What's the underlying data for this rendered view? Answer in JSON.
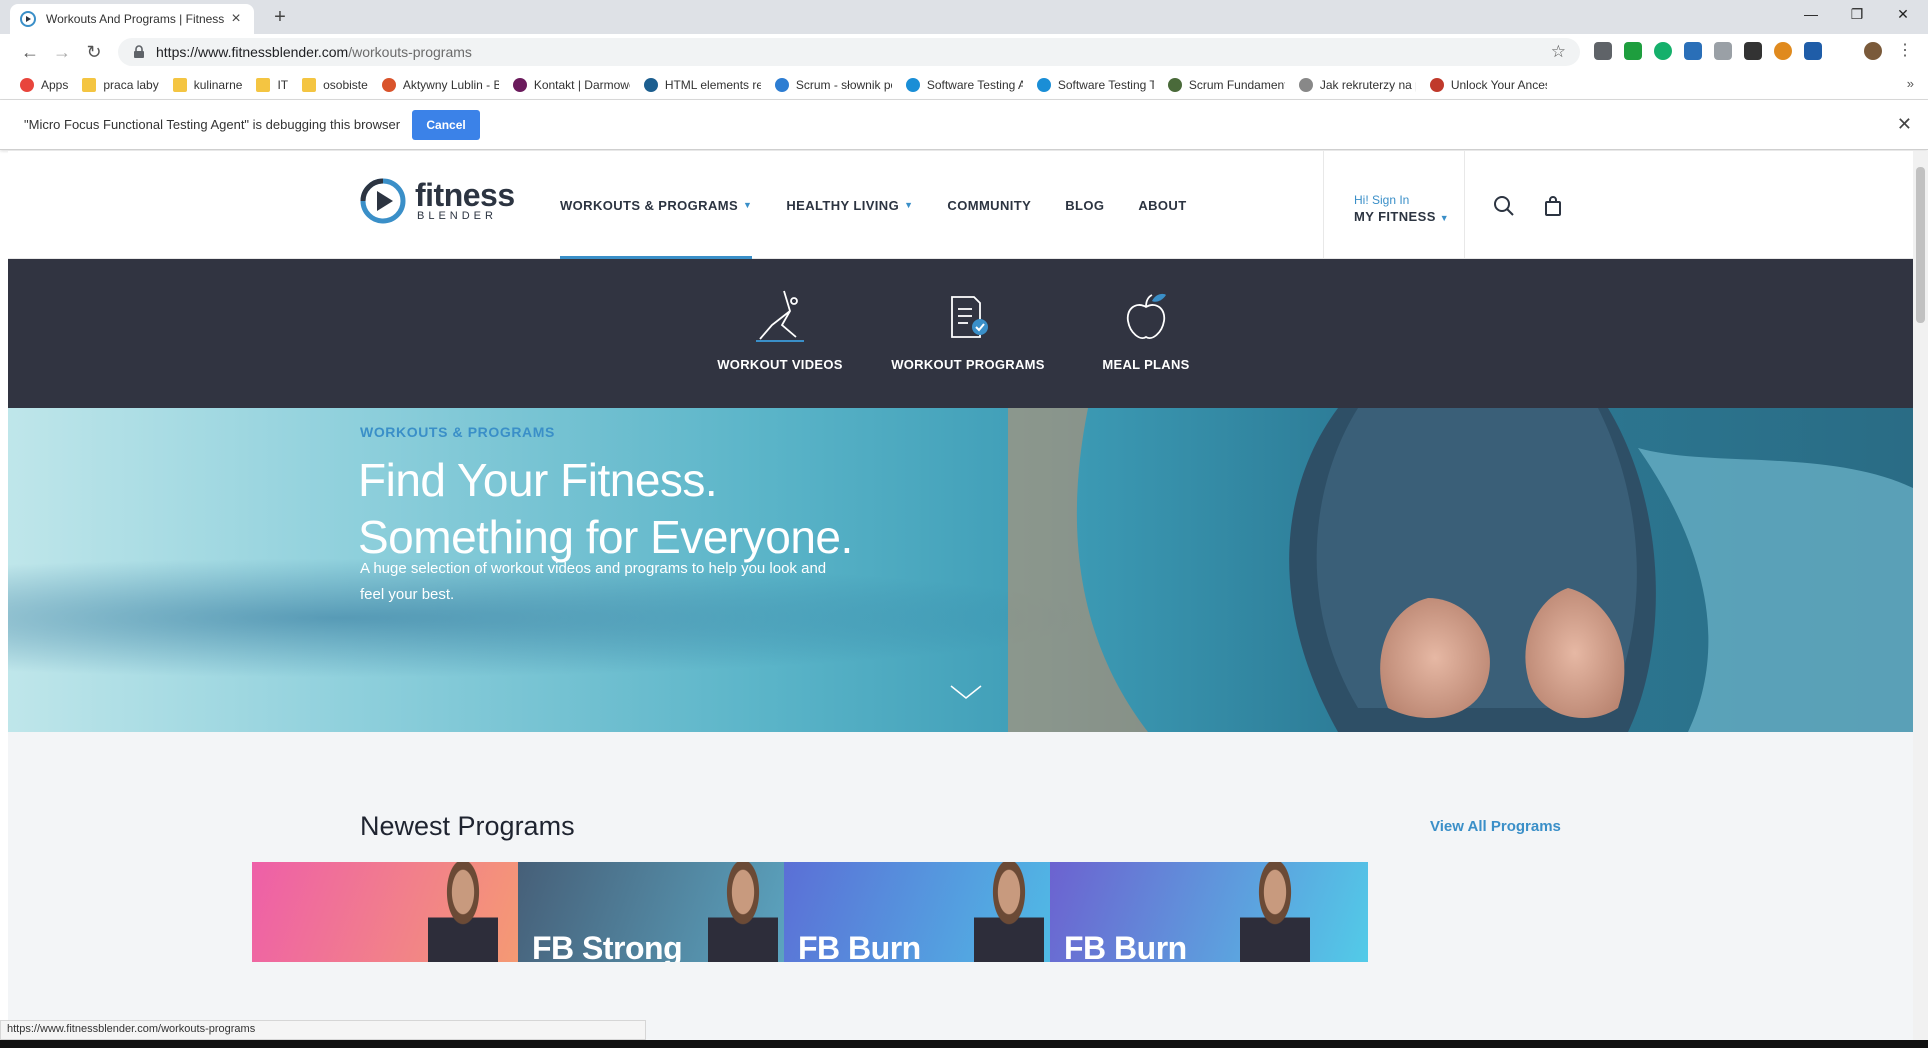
{
  "browser": {
    "tab_title": "Workouts And Programs | Fitness",
    "url_host": "https://www.fitnessblender.com",
    "url_path": "/workouts-programs",
    "bookmarks": [
      {
        "label": "Apps",
        "icon": "apps-grid-icon",
        "color": "#e8453c"
      },
      {
        "label": "praca laby",
        "icon": "folder-icon",
        "color": "#f4c542"
      },
      {
        "label": "kulinarne",
        "icon": "folder-icon",
        "color": "#f4c542"
      },
      {
        "label": "IT",
        "icon": "folder-icon",
        "color": "#f4c542"
      },
      {
        "label": "osobiste",
        "icon": "folder-icon",
        "color": "#f4c542"
      },
      {
        "label": "Aktywny Lublin - Bud",
        "icon": "clock-icon",
        "color": "#d9532b"
      },
      {
        "label": "Kontakt | Darmowe S",
        "icon": "3d-icon",
        "color": "#6b1b5c"
      },
      {
        "label": "HTML elements refer",
        "icon": "graduation-icon",
        "color": "#1c5e8f"
      },
      {
        "label": "Scrum - słownik poję",
        "icon": "arrow-icon",
        "color": "#2d7dd2"
      },
      {
        "label": "Software Testing Arti",
        "icon": "u-circle-icon",
        "color": "#1a8ed6"
      },
      {
        "label": "Software Testing Too",
        "icon": "u-circle-icon",
        "color": "#1a8ed6"
      },
      {
        "label": "Scrum Fundamentals",
        "icon": "gear-icon",
        "color": "#4a6a3a"
      },
      {
        "label": "Jak rekruterzy na poc",
        "icon": "page-icon",
        "color": "#888888"
      },
      {
        "label": "Unlock Your Ancestry",
        "icon": "ancestry-icon",
        "color": "#c0392b"
      }
    ],
    "debug_message": "\"Micro Focus Functional Testing Agent\" is debugging this browser",
    "cancel_label": "Cancel",
    "status_url": "https://www.fitnessblender.com/workouts-programs"
  },
  "site": {
    "logo_word1": "fitness",
    "logo_word2": "BLENDER",
    "nav": [
      {
        "label": "WORKOUTS & PROGRAMS",
        "has_caret": true,
        "active": true
      },
      {
        "label": "HEALTHY LIVING",
        "has_caret": true,
        "active": false
      },
      {
        "label": "COMMUNITY",
        "has_caret": false,
        "active": false
      },
      {
        "label": "BLOG",
        "has_caret": false,
        "active": false
      },
      {
        "label": "ABOUT",
        "has_caret": false,
        "active": false
      }
    ],
    "account_greeting": "Hi! Sign In",
    "account_menu": "MY FITNESS",
    "subnav": [
      {
        "label": "WORKOUT VIDEOS",
        "icon": "stretching-person-icon"
      },
      {
        "label": "WORKOUT PROGRAMS",
        "icon": "checklist-icon"
      },
      {
        "label": "MEAL PLANS",
        "icon": "apple-icon"
      }
    ],
    "hero": {
      "eyebrow": "WORKOUTS & PROGRAMS",
      "headline_line1": "Find Your Fitness.",
      "headline_line2": "Something for Everyone.",
      "lead": "A huge selection of workout videos and programs to help you look and feel your best."
    },
    "newest": {
      "title": "Newest Programs",
      "view_all": "View All Programs",
      "cards": [
        {
          "title": "",
          "bg_from": "#ee5fa8",
          "bg_to": "#f6a46a"
        },
        {
          "title": "FB Strong",
          "bg_from": "#465f78",
          "bg_to": "#5fb0cc"
        },
        {
          "title": "FB Burn",
          "bg_from": "#5b6fd6",
          "bg_to": "#4ec8e8"
        },
        {
          "title": "FB Burn",
          "bg_from": "#6c62d0",
          "bg_to": "#52cbe8"
        }
      ]
    },
    "colors": {
      "accent": "#3a8fc8",
      "dark_nav": "#313441",
      "text_dark": "#2c3441"
    }
  }
}
